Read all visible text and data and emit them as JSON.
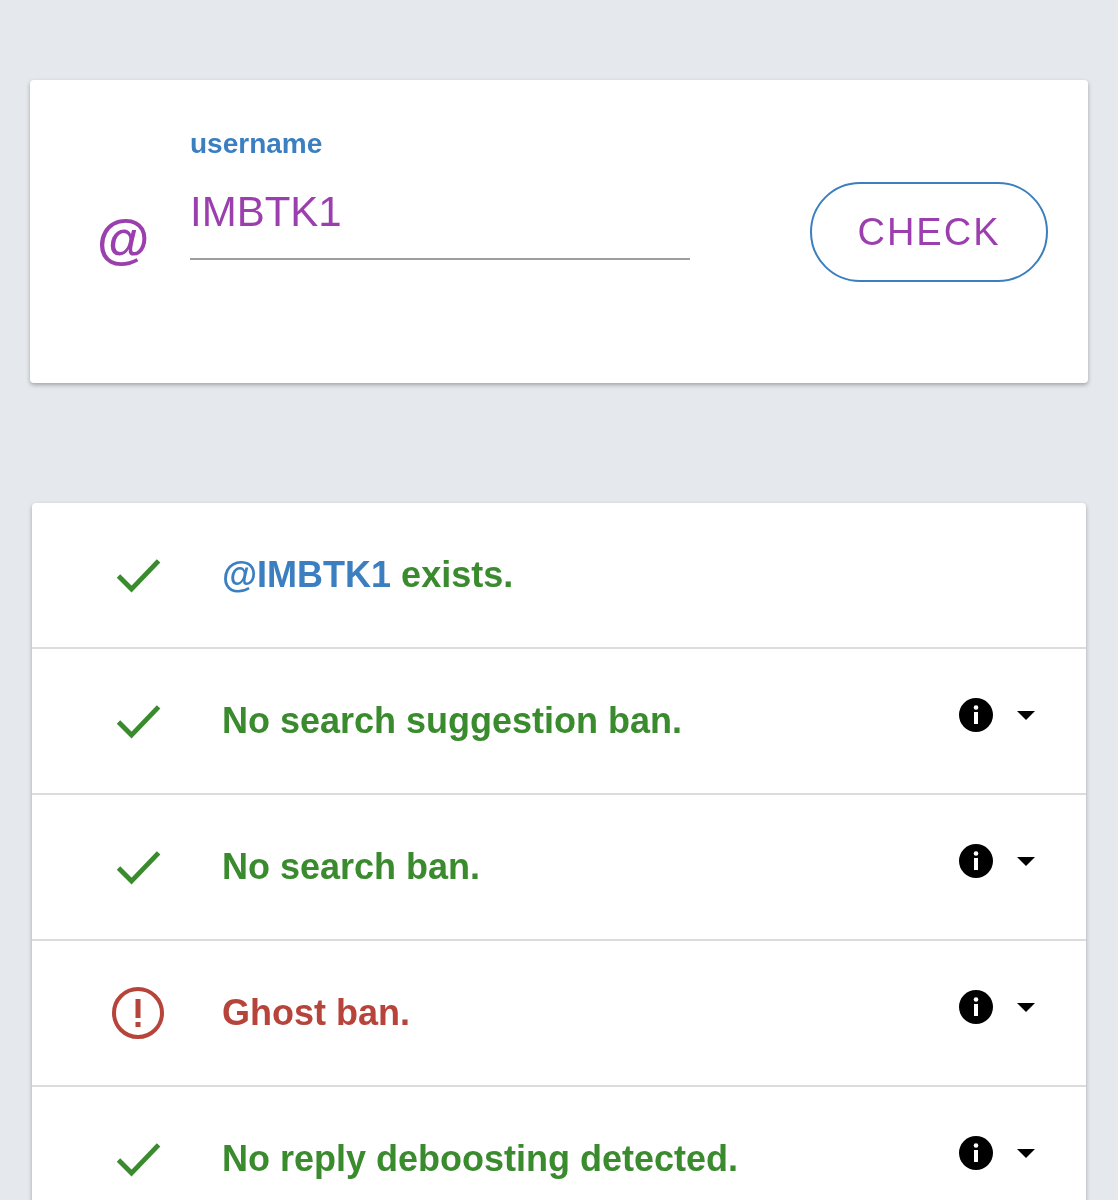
{
  "username_form": {
    "label": "username",
    "prefix": "@",
    "value": "IMBTK1",
    "button": "CHECK"
  },
  "results": [
    {
      "kind": "check",
      "handle": "@IMBTK1",
      "text": " exists.",
      "expandable": false
    },
    {
      "kind": "check",
      "text": "No search suggestion ban.",
      "expandable": true
    },
    {
      "kind": "check",
      "text": "No search ban.",
      "expandable": true
    },
    {
      "kind": "warning",
      "text": "Ghost ban.",
      "expandable": true
    },
    {
      "kind": "check",
      "text": "No reply deboosting detected.",
      "expandable": true
    }
  ]
}
